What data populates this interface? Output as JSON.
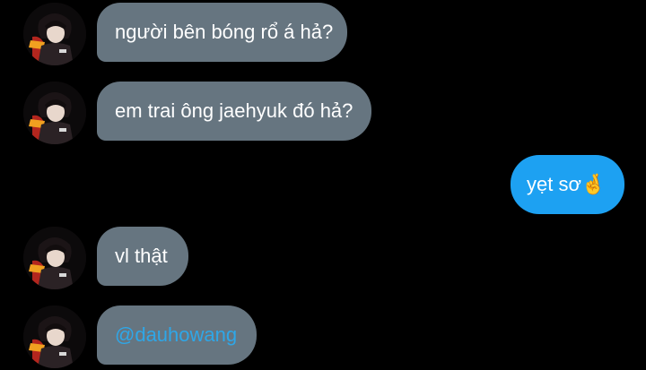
{
  "conversation": {
    "messages": [
      {
        "sender": "other",
        "text": "người bên bóng rổ á hả?"
      },
      {
        "sender": "other",
        "text": "em trai ông jaehyuk đó hả?"
      },
      {
        "sender": "self",
        "text": "yẹt sơ🤞"
      },
      {
        "sender": "other",
        "text": "vl thật"
      },
      {
        "sender": "other",
        "text": "@dauhowang",
        "is_mention": true
      }
    ]
  },
  "colors": {
    "background": "#000000",
    "incoming_bubble": "#667580",
    "outgoing_bubble": "#1da1f2",
    "mention": "#2ea7e8",
    "text": "#ffffff"
  }
}
